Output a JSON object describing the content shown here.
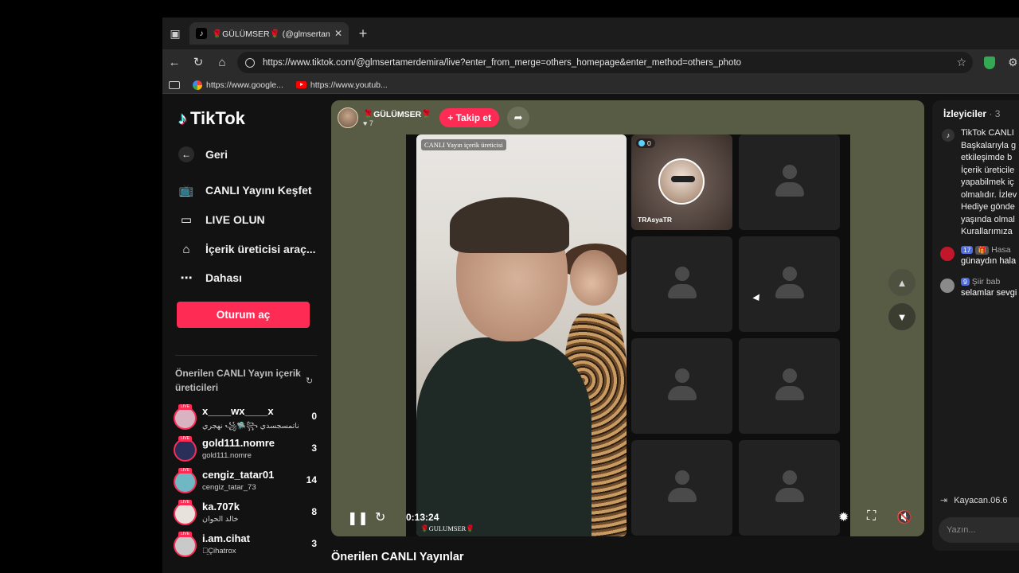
{
  "browser": {
    "tab_title": "🌹GÜLÜMSER🌹 (@glmsertamerdemira)",
    "address": "https://www.tiktok.com/@glmsertamerdemira/live?enter_from_merge=others_homepage&enter_method=others_photo",
    "bookmarks": [
      {
        "label": "https://www.google...",
        "icon": "google-icon"
      },
      {
        "label": "https://www.youtub...",
        "icon": "youtube-icon"
      }
    ]
  },
  "sidebar": {
    "logo": "TikTok",
    "nav": [
      {
        "label": "Geri",
        "icon": "back-arrow-icon"
      },
      {
        "label": "CANLI Yayını Keşfet",
        "icon": "live-tv-icon"
      },
      {
        "label": "LIVE OLUN",
        "icon": "camera-icon"
      },
      {
        "label": "İçerik üreticisi araç...",
        "icon": "creator-home-icon"
      },
      {
        "label": "Dahası",
        "icon": "more-icon"
      }
    ],
    "login_label": "Oturum aç",
    "suggested_title": "Önerilen CANLI Yayın içerik üreticileri",
    "creators": [
      {
        "name": "x____wx____x",
        "sub": "نهجري ꧁🛸꧂ ناتمسجسدي",
        "count": "0",
        "live_label": "LIVE"
      },
      {
        "name": "gold111.nomre",
        "sub": "gold111.nomre",
        "count": "3",
        "live_label": "LIVE"
      },
      {
        "name": "cengiz_tatar01",
        "sub": "cengiz_tatar_73",
        "count": "14",
        "live_label": "LIVE"
      },
      {
        "name": "ka.707k",
        "sub": "خالد الحوان",
        "count": "8",
        "live_label": "LIVE"
      },
      {
        "name": "i.am.cihat",
        "sub": "ꪖ̤Çihatrox",
        "count": "3",
        "live_label": "LIVE"
      }
    ]
  },
  "live": {
    "host_name": "🌹GÜLÜMSER🌹",
    "host_likes": "♥ 7",
    "follow_label": "+ Takip et",
    "main_feed_label": "CANLI Yayın içerik üreticisi",
    "guest_viewers": "0",
    "guest_name": "TRAsyaTR",
    "time": "0:13:24",
    "bottom_host": "🌹GULUMSER🌹",
    "suggested_lives": "Önerilen CANLI Yayınlar"
  },
  "chat": {
    "title": "İzleyiciler",
    "viewer_count": "· 3",
    "system_lines": [
      "TikTok CANLI",
      "Başkalarıyla g",
      "etkileşimde b",
      "İçerik üreticile",
      "yapabilmek iç",
      "olmalıdır. İzlev",
      "Hediye gönde",
      "yaşında olmal",
      "Kurallarımıza"
    ],
    "messages": [
      {
        "level": "17",
        "gift": "🎁",
        "user": "Hasa",
        "text": "günaydın hala",
        "avatar_color": "#c2172a"
      },
      {
        "level": "9",
        "gift": "",
        "user": "Şiir bab",
        "text": "selamlar sevgi",
        "avatar_color": "#8a8a8a"
      }
    ],
    "join_text": "Kayacan.06.6",
    "input_placeholder": "Yazın..."
  }
}
